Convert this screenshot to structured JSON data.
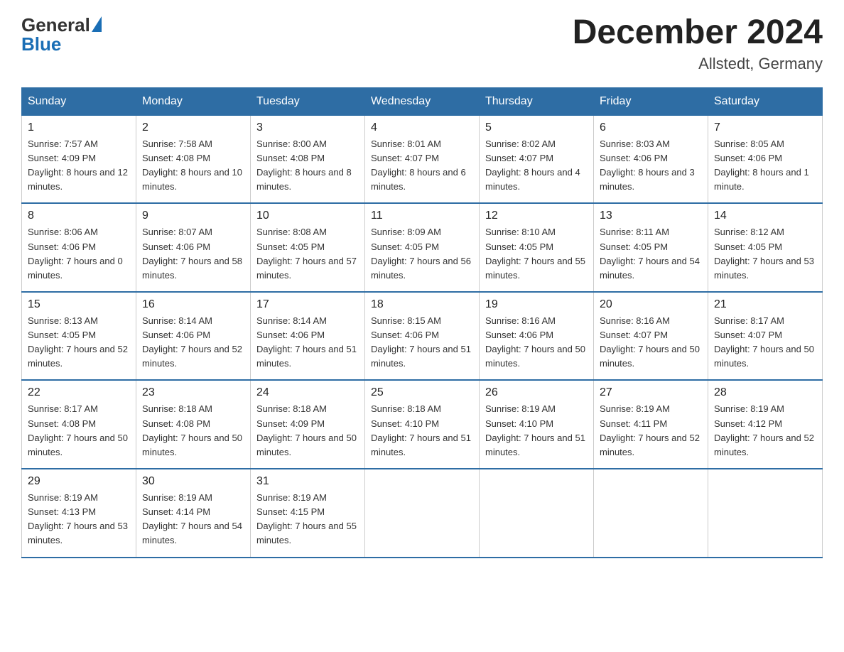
{
  "logo": {
    "general": "General",
    "blue": "Blue"
  },
  "title": "December 2024",
  "subtitle": "Allstedt, Germany",
  "days_of_week": [
    "Sunday",
    "Monday",
    "Tuesday",
    "Wednesday",
    "Thursday",
    "Friday",
    "Saturday"
  ],
  "weeks": [
    [
      {
        "day": "1",
        "sunrise": "7:57 AM",
        "sunset": "4:09 PM",
        "daylight": "8 hours and 12 minutes."
      },
      {
        "day": "2",
        "sunrise": "7:58 AM",
        "sunset": "4:08 PM",
        "daylight": "8 hours and 10 minutes."
      },
      {
        "day": "3",
        "sunrise": "8:00 AM",
        "sunset": "4:08 PM",
        "daylight": "8 hours and 8 minutes."
      },
      {
        "day": "4",
        "sunrise": "8:01 AM",
        "sunset": "4:07 PM",
        "daylight": "8 hours and 6 minutes."
      },
      {
        "day": "5",
        "sunrise": "8:02 AM",
        "sunset": "4:07 PM",
        "daylight": "8 hours and 4 minutes."
      },
      {
        "day": "6",
        "sunrise": "8:03 AM",
        "sunset": "4:06 PM",
        "daylight": "8 hours and 3 minutes."
      },
      {
        "day": "7",
        "sunrise": "8:05 AM",
        "sunset": "4:06 PM",
        "daylight": "8 hours and 1 minute."
      }
    ],
    [
      {
        "day": "8",
        "sunrise": "8:06 AM",
        "sunset": "4:06 PM",
        "daylight": "7 hours and 0 minutes."
      },
      {
        "day": "9",
        "sunrise": "8:07 AM",
        "sunset": "4:06 PM",
        "daylight": "7 hours and 58 minutes."
      },
      {
        "day": "10",
        "sunrise": "8:08 AM",
        "sunset": "4:05 PM",
        "daylight": "7 hours and 57 minutes."
      },
      {
        "day": "11",
        "sunrise": "8:09 AM",
        "sunset": "4:05 PM",
        "daylight": "7 hours and 56 minutes."
      },
      {
        "day": "12",
        "sunrise": "8:10 AM",
        "sunset": "4:05 PM",
        "daylight": "7 hours and 55 minutes."
      },
      {
        "day": "13",
        "sunrise": "8:11 AM",
        "sunset": "4:05 PM",
        "daylight": "7 hours and 54 minutes."
      },
      {
        "day": "14",
        "sunrise": "8:12 AM",
        "sunset": "4:05 PM",
        "daylight": "7 hours and 53 minutes."
      }
    ],
    [
      {
        "day": "15",
        "sunrise": "8:13 AM",
        "sunset": "4:05 PM",
        "daylight": "7 hours and 52 minutes."
      },
      {
        "day": "16",
        "sunrise": "8:14 AM",
        "sunset": "4:06 PM",
        "daylight": "7 hours and 52 minutes."
      },
      {
        "day": "17",
        "sunrise": "8:14 AM",
        "sunset": "4:06 PM",
        "daylight": "7 hours and 51 minutes."
      },
      {
        "day": "18",
        "sunrise": "8:15 AM",
        "sunset": "4:06 PM",
        "daylight": "7 hours and 51 minutes."
      },
      {
        "day": "19",
        "sunrise": "8:16 AM",
        "sunset": "4:06 PM",
        "daylight": "7 hours and 50 minutes."
      },
      {
        "day": "20",
        "sunrise": "8:16 AM",
        "sunset": "4:07 PM",
        "daylight": "7 hours and 50 minutes."
      },
      {
        "day": "21",
        "sunrise": "8:17 AM",
        "sunset": "4:07 PM",
        "daylight": "7 hours and 50 minutes."
      }
    ],
    [
      {
        "day": "22",
        "sunrise": "8:17 AM",
        "sunset": "4:08 PM",
        "daylight": "7 hours and 50 minutes."
      },
      {
        "day": "23",
        "sunrise": "8:18 AM",
        "sunset": "4:08 PM",
        "daylight": "7 hours and 50 minutes."
      },
      {
        "day": "24",
        "sunrise": "8:18 AM",
        "sunset": "4:09 PM",
        "daylight": "7 hours and 50 minutes."
      },
      {
        "day": "25",
        "sunrise": "8:18 AM",
        "sunset": "4:10 PM",
        "daylight": "7 hours and 51 minutes."
      },
      {
        "day": "26",
        "sunrise": "8:19 AM",
        "sunset": "4:10 PM",
        "daylight": "7 hours and 51 minutes."
      },
      {
        "day": "27",
        "sunrise": "8:19 AM",
        "sunset": "4:11 PM",
        "daylight": "7 hours and 52 minutes."
      },
      {
        "day": "28",
        "sunrise": "8:19 AM",
        "sunset": "4:12 PM",
        "daylight": "7 hours and 52 minutes."
      }
    ],
    [
      {
        "day": "29",
        "sunrise": "8:19 AM",
        "sunset": "4:13 PM",
        "daylight": "7 hours and 53 minutes."
      },
      {
        "day": "30",
        "sunrise": "8:19 AM",
        "sunset": "4:14 PM",
        "daylight": "7 hours and 54 minutes."
      },
      {
        "day": "31",
        "sunrise": "8:19 AM",
        "sunset": "4:15 PM",
        "daylight": "7 hours and 55 minutes."
      },
      null,
      null,
      null,
      null
    ]
  ]
}
